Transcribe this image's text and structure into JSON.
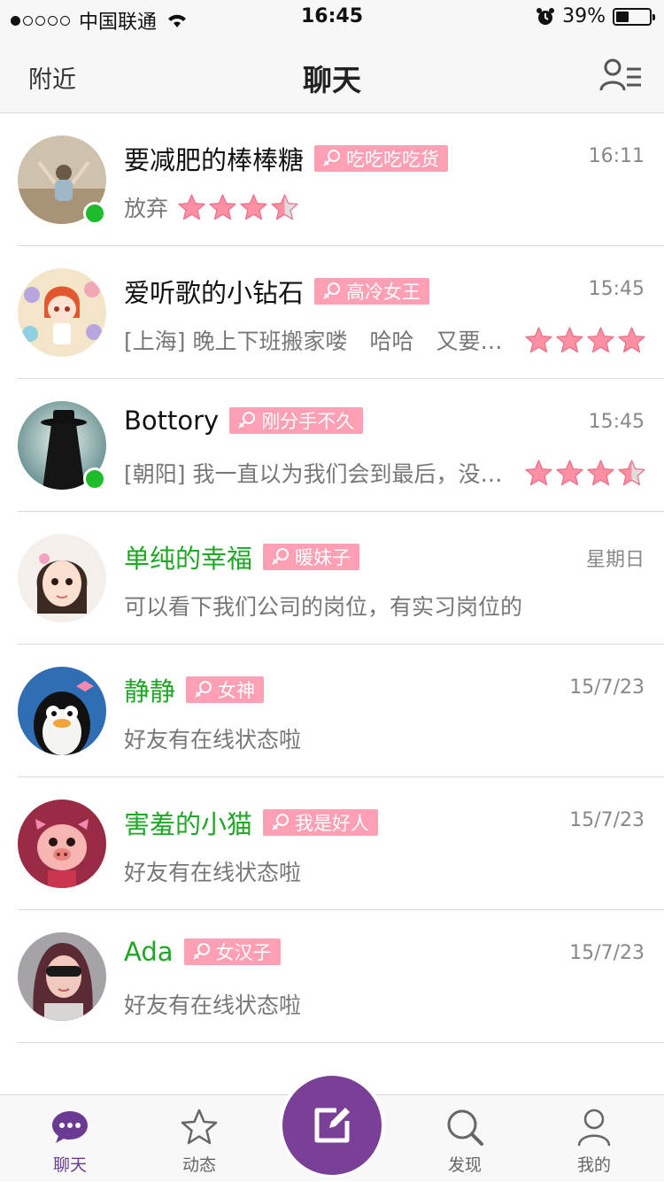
{
  "status_bar": {
    "carrier": "中国联通",
    "time": "16:45",
    "battery": "39%",
    "battery_level": 0.39
  },
  "nav": {
    "left": "附近",
    "title": "聊天"
  },
  "chats": [
    {
      "name": "要减肥的棒棒糖",
      "tag": "吃吃吃吃货",
      "time": "16:11",
      "message": "放弃",
      "stars": 3.5,
      "stars_inline": true,
      "online": true,
      "name_color": "#111111"
    },
    {
      "name": "爱听歌的小钻石",
      "tag": "高冷女王",
      "time": "15:45",
      "message": "[上海] 晚上下班搬家喽　哈哈　又要住的离公司很近了",
      "stars": 4,
      "stars_inline": false,
      "online": false,
      "name_color": "#111111"
    },
    {
      "name": "Bottory",
      "tag": "刚分手不久",
      "time": "15:45",
      "message": "[朝阳] 我一直以为我们会到最后，没想到",
      "stars": 3.5,
      "stars_inline": false,
      "online": true,
      "name_color": "#111111"
    },
    {
      "name": "单纯的幸福",
      "tag": "暖妹子",
      "time": "星期日",
      "message": "可以看下我们公司的岗位，有实习岗位的",
      "stars": 0,
      "online": false,
      "name_color": "#1ea625"
    },
    {
      "name": "静静",
      "tag": "女神",
      "time": "15/7/23",
      "message": "好友有在线状态啦",
      "stars": 0,
      "online": false,
      "name_color": "#1ea625"
    },
    {
      "name": "害羞的小猫",
      "tag": "我是好人",
      "time": "15/7/23",
      "message": "好友有在线状态啦",
      "stars": 0,
      "online": false,
      "name_color": "#1ea625"
    },
    {
      "name": "Ada",
      "tag": "女汉子",
      "time": "15/7/23",
      "message": "好友有在线状态啦",
      "stars": 0,
      "online": false,
      "name_color": "#1ea625"
    }
  ],
  "tabbar": {
    "chat": "聊天",
    "moments": "动态",
    "discover": "发现",
    "me": "我的"
  },
  "colors": {
    "accent": "#7a3f96",
    "tag_bg": "#ff9fb4",
    "online": "#1cbc2b",
    "green_name": "#1ea625"
  }
}
